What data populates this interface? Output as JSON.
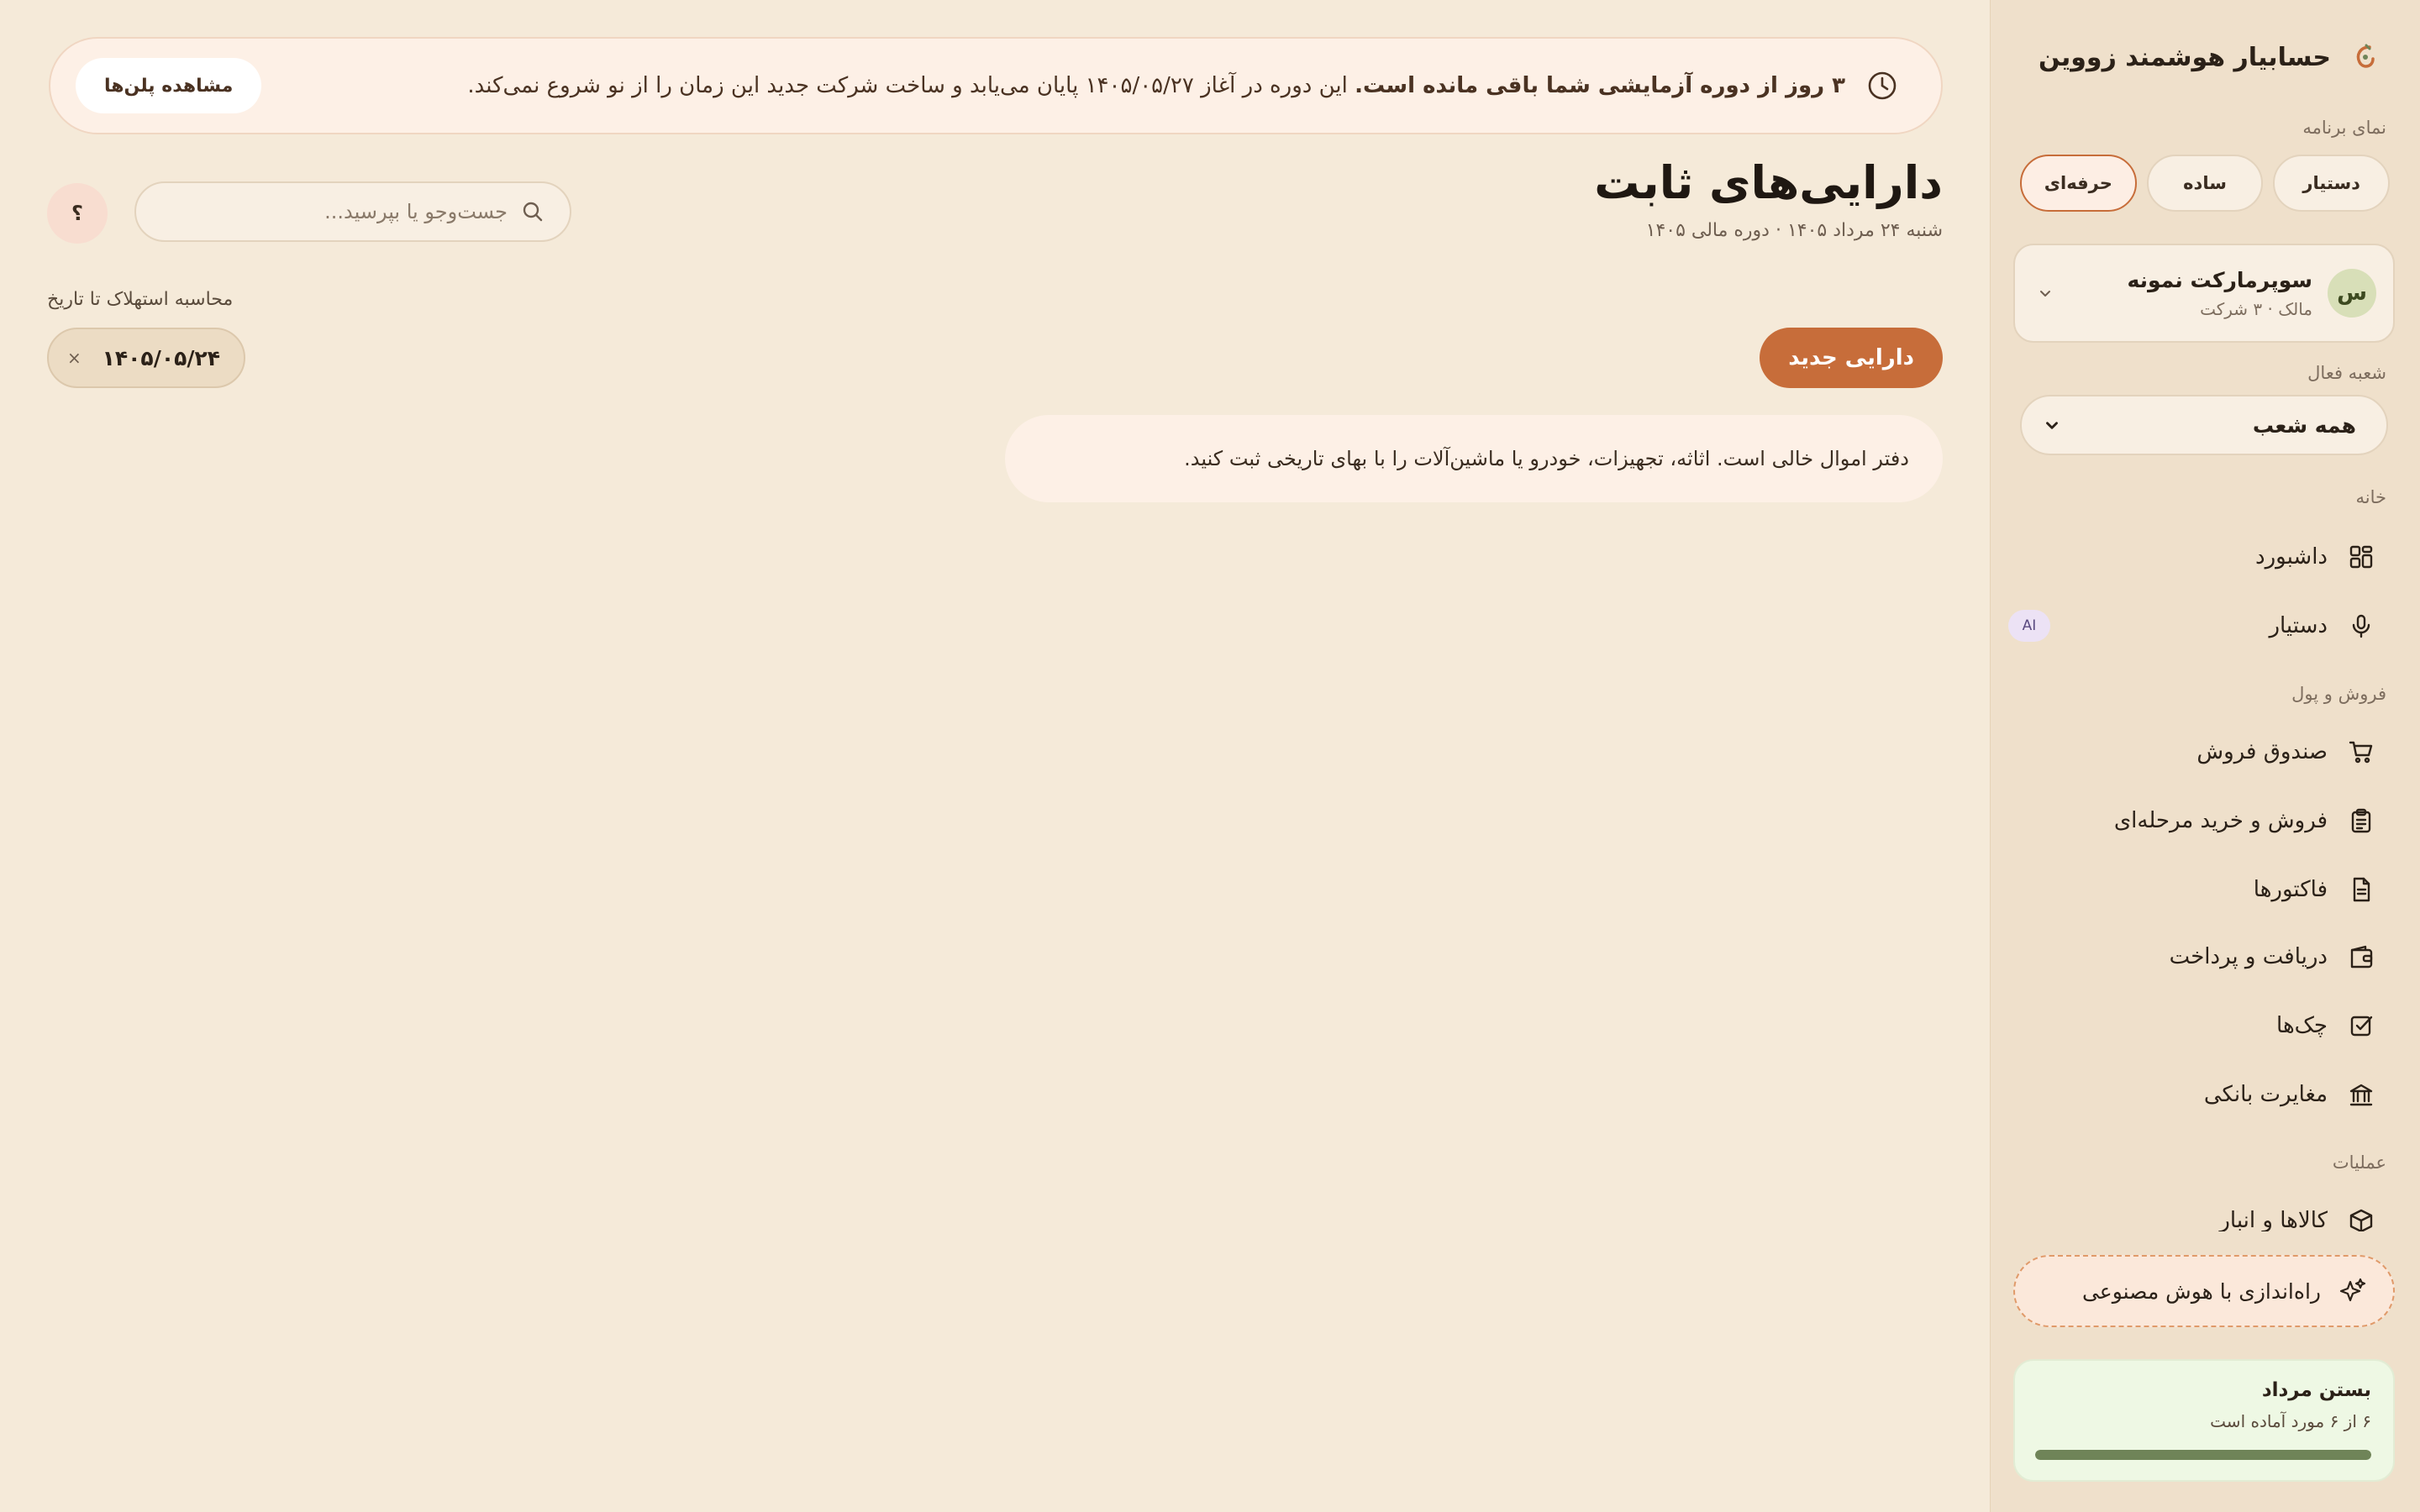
{
  "app": {
    "title": "حسابیار هوشمند زووین"
  },
  "sidebar": {
    "view_label": "نمای برنامه",
    "views": [
      {
        "label": "دستیار",
        "active": false
      },
      {
        "label": "ساده",
        "active": false
      },
      {
        "label": "حرفه‌ای",
        "active": true
      }
    ],
    "company": {
      "avatar": "س",
      "name": "سوپرمارکت نمونه",
      "role": "مالک · ۳ شرکت"
    },
    "branch": {
      "label": "شعبه فعال",
      "value": "همه شعب"
    },
    "sections": {
      "home": "خانه",
      "sales": "فروش و پول",
      "ops": "عملیات"
    },
    "nav": {
      "dashboard": {
        "label": "داشبورد",
        "icon": "dashboard-icon"
      },
      "assistant": {
        "label": "دستیار",
        "icon": "microphone-icon",
        "badge": "AI"
      },
      "pos": {
        "label": "صندوق فروش",
        "icon": "cart-icon"
      },
      "staged": {
        "label": "فروش و خرید مرحله‌ای",
        "icon": "clipboard-icon"
      },
      "invoices": {
        "label": "فاکتورها",
        "icon": "document-icon"
      },
      "payments": {
        "label": "دریافت و پرداخت",
        "icon": "wallet-icon"
      },
      "cheques": {
        "label": "چک‌ها",
        "icon": "checkbox-icon"
      },
      "bank": {
        "label": "مغایرت بانکی",
        "icon": "bank-icon"
      },
      "inventory": {
        "label": "کالاها و انبار",
        "icon": "box-icon"
      }
    },
    "ai_setup": {
      "label": "راه‌اندازی با هوش مصنوعی",
      "icon": "sparkle-icon"
    },
    "month_close": {
      "title": "بستن مرداد",
      "subtitle": "۶ از ۶ مورد آماده است",
      "progress": 1.0
    }
  },
  "banner": {
    "bold": "۳ روز از دوره آزمایشی شما باقی مانده است.",
    "text": " این دوره در آغاز ۱۴۰۵/۰۵/۲۷ پایان می‌یابد و ساخت شرکت جدید این زمان را از نو شروع نمی‌کند.",
    "button": "مشاهده پلن‌ها"
  },
  "page": {
    "title": "دارایی‌های ثابت",
    "subtitle": "شنبه ۲۴ مرداد ۱۴۰۵ · دوره مالی ۱۴۰۵",
    "new_button": "دارایی جدید",
    "empty_text": "دفتر اموال خالی است. اثاثه، تجهیزات، خودرو یا ماشین‌آلات را با بهای تاریخی ثبت کنید."
  },
  "search": {
    "placeholder": "جست‌وجو یا بپرسید..."
  },
  "help": {
    "label": "؟"
  },
  "depreciation": {
    "label": "محاسبه استهلاک تا تاریخ",
    "date": "۱۴۰۵/۰۵/۲۴",
    "clear": "×"
  },
  "colors": {
    "accent": "#c76d3a",
    "background": "#f5ead9",
    "sidebar": "#efe0cb",
    "progress": "#6f8458"
  }
}
